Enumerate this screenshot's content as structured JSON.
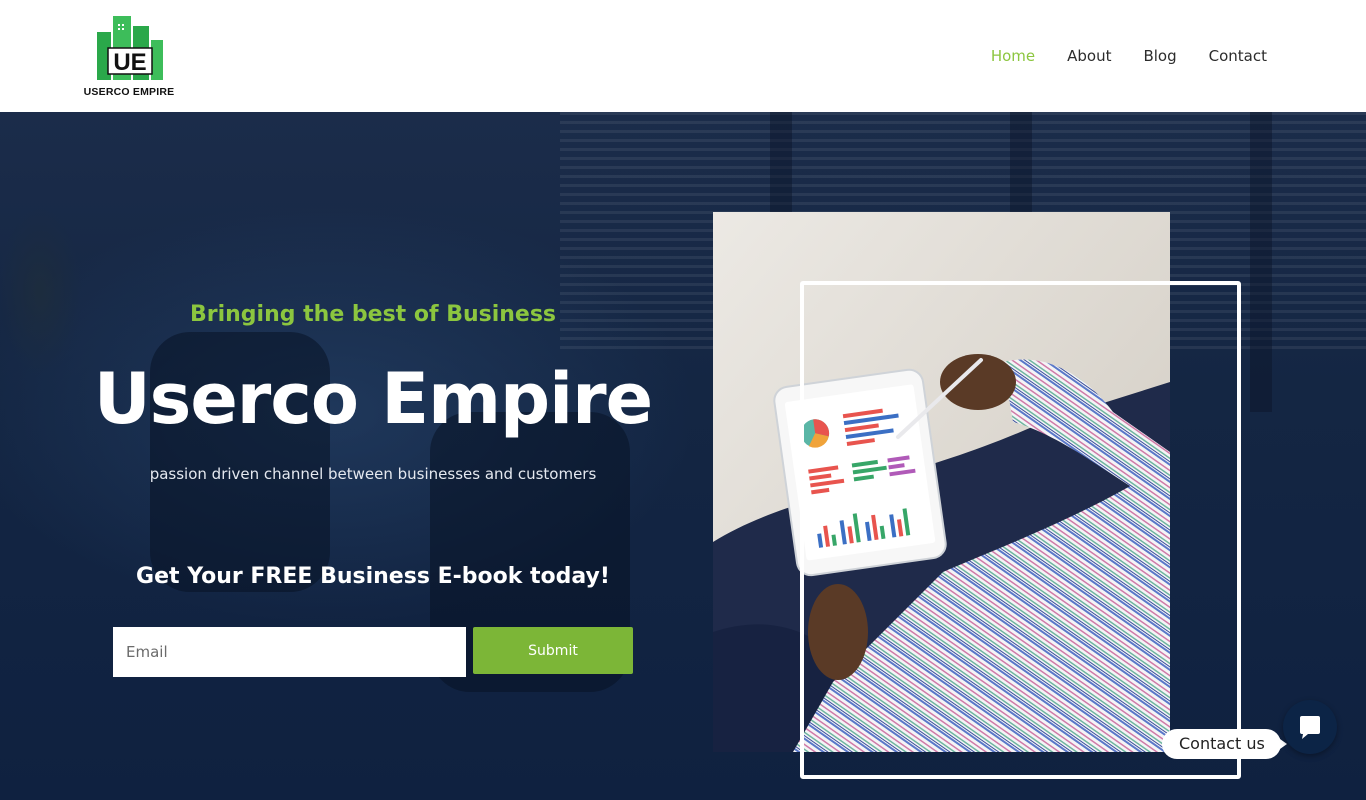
{
  "header": {
    "logo_text": "USERCO EMPIRE",
    "nav": [
      {
        "label": "Home",
        "active": true
      },
      {
        "label": "About",
        "active": false
      },
      {
        "label": "Blog",
        "active": false
      },
      {
        "label": "Contact",
        "active": false
      }
    ]
  },
  "hero": {
    "tagline": "Bringing the best of Business",
    "title": "Userco Empire",
    "subtitle": "passion driven channel between businesses and customers",
    "cta_heading": "Get Your FREE Business E-book today!",
    "email_placeholder": "Email",
    "submit_label": "Submit"
  },
  "floating_contact": {
    "label": "Contact us",
    "icon": "chat-bubble-icon"
  },
  "colors": {
    "accent_green": "#8cc63f",
    "button_green": "#7cb637",
    "hero_navy": "#142643"
  }
}
